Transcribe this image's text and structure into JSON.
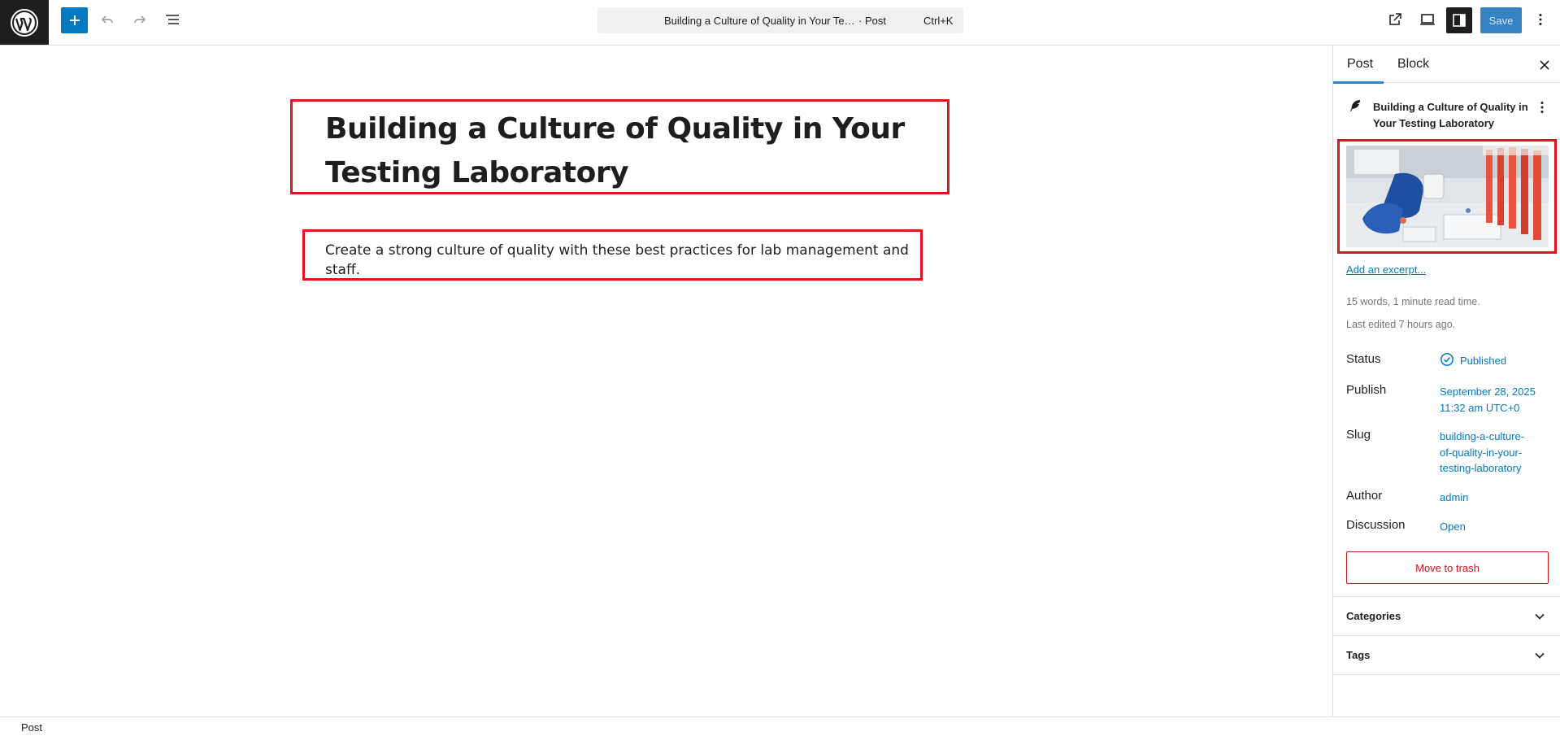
{
  "toolbar": {
    "logo_icon": "wordpress-logo-icon",
    "add_icon": "plus-icon",
    "undo_icon": "undo-icon",
    "redo_icon": "redo-icon",
    "document_overview_icon": "list-view-icon",
    "command_title": "Building a Culture of Quality in Your Testing Laboratory",
    "command_type": "· Post",
    "command_shortcut": "Ctrl+K",
    "view_icon": "external-link-icon",
    "device_icon": "desktop-preview-icon",
    "settings_icon": "sidebar-settings-icon",
    "save_label": "Save",
    "options_icon": "more-vertical-icon",
    "accent": "#0079c0"
  },
  "editor": {
    "title": "Building a Culture of Quality in Your Testing Laboratory",
    "excerpt": "Create a strong culture of quality with these best practices for lab management and staff."
  },
  "sidebar": {
    "tabs": [
      {
        "label": "Post"
      },
      {
        "label": "Block"
      }
    ],
    "close_icon": "close-icon",
    "post_icon": "feather-icon",
    "post_title": "Building a Culture of Quality in Your Testing Laboratory",
    "post_more_icon": "more-vertical-icon",
    "featured_image_alt": "Gloved hands working with test tubes in a laboratory",
    "add_excerpt": "Add an excerpt...",
    "word_count": "15 words, 1 minute read time.",
    "last_edited": "Last edited 7 hours ago.",
    "properties": {
      "status": {
        "label": "Status",
        "value": "Published",
        "icon": "published-check-icon"
      },
      "publish": {
        "label": "Publish",
        "value_line1": "September 28, 2025",
        "value_line2": "11:32 am UTC+0"
      },
      "slug": {
        "label": "Slug",
        "value_line1": "building-a-culture-",
        "value_line2": "of-quality-in-your-",
        "value_line3": "testing-laboratory"
      },
      "author": {
        "label": "Author",
        "value": "admin"
      },
      "discussion": {
        "label": "Discussion",
        "value": "Open"
      }
    },
    "trash_label": "Move to trash",
    "danger_color": "#cc1818",
    "panels": [
      {
        "label": "Categories",
        "icon": "chevron-down-icon"
      },
      {
        "label": "Tags",
        "icon": "chevron-down-icon"
      }
    ]
  },
  "footer": {
    "breadcrumb": "Post"
  },
  "annotation_color": "#e3151c"
}
